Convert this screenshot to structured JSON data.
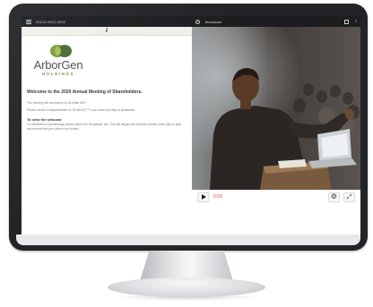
{
  "left_panel": {
    "meeting_id": "20212-0912-0002",
    "logo": {
      "name": "ArborGen",
      "sub": "HOLDINGS"
    },
    "welcome": "Welcome to the 2020 Annual Meeting of Shareholders.",
    "para1": "The meeting will commence at 10:00am MST",
    "para2": "Please contact Computershare on 00-489-8777 if you need any help or assistance.",
    "to_view_title": "To view the webcast",
    "para3": "To view/listen to proceedings please select the 'Broadcast' bar. This will display the webcast, please press play to start and ensure that your device isn't muted."
  },
  "right_panel": {
    "broadcast_label": "Broadcast",
    "time": "0:03",
    "icons": [
      "broadcast-icon",
      "fullscreen-icon",
      "chevron-right-icon",
      "play-icon",
      "gear-icon",
      "expand-icon"
    ]
  },
  "colors": {
    "brand_green": "#6e8f3a",
    "brand_dark_green": "#4c6d35",
    "time_red": "#e2422f",
    "topbar": "#1c1d1f"
  }
}
